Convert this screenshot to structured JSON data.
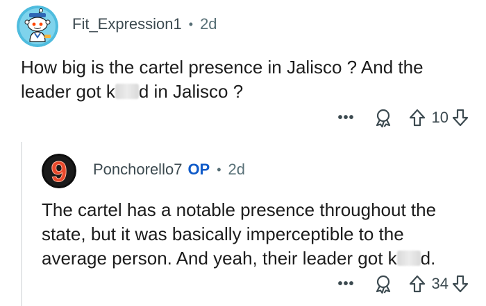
{
  "comment1": {
    "username": "Fit_Expression1",
    "separator": "•",
    "age": "2d",
    "body_before": "How big is the cartel presence in Jalisco ? And the leader got k",
    "body_after": "d in Jalisco ?",
    "score": "10",
    "more_label": "•••"
  },
  "comment2": {
    "avatar_glyph": "9",
    "username": "Ponchorello7",
    "op_badge": "OP",
    "separator": "•",
    "age": "2d",
    "body_before": "The cartel has a notable presence throughout the state, but it was basically imperceptible to the average person. And yeah, their leader got k",
    "body_after": "d.",
    "score": "34",
    "more_label": "•••"
  },
  "colors": {
    "meta_text": "#576f76",
    "op_badge": "#0f5ac8",
    "thread_line": "#e4e6e8",
    "avatar1_bg": "#4fbcde",
    "avatar2_ring": "#e8482b"
  },
  "icons": [
    "snoo-avatar-icon",
    "more-options-icon",
    "award-icon",
    "upvote-arrow-icon",
    "downvote-arrow-icon"
  ]
}
